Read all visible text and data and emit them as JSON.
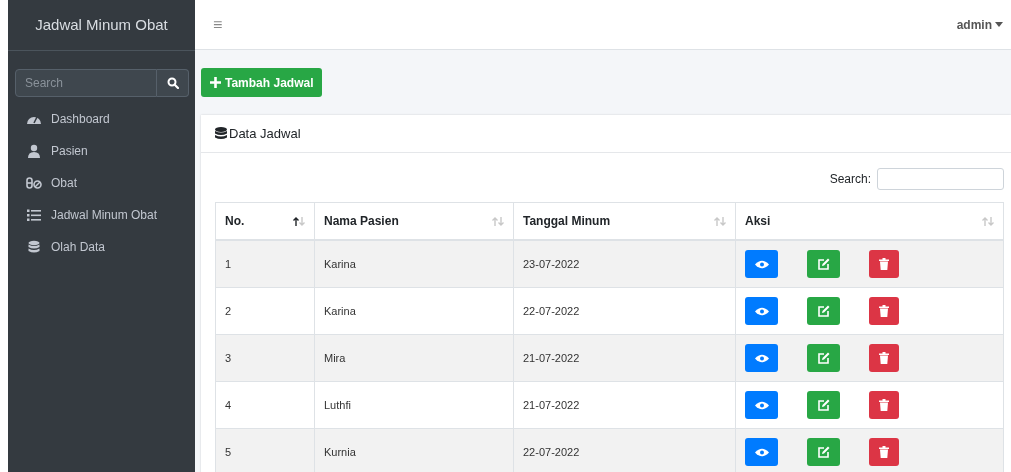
{
  "sidebar": {
    "brand": "Jadwal Minum Obat",
    "search": {
      "placeholder": "Search"
    },
    "items": [
      {
        "label": "Dashboard"
      },
      {
        "label": "Pasien"
      },
      {
        "label": "Obat"
      },
      {
        "label": "Jadwal Minum Obat"
      },
      {
        "label": "Olah Data"
      }
    ]
  },
  "topbar": {
    "menu_icon": "≡",
    "user": "admin"
  },
  "add_button": "Tambah Jadwal",
  "card": {
    "title": "Data Jadwal",
    "search_label": "Search:",
    "columns": [
      {
        "label": "No.",
        "sorted": true
      },
      {
        "label": "Nama Pasien",
        "sorted": false
      },
      {
        "label": "Tanggal Minum",
        "sorted": false
      },
      {
        "label": "Aksi",
        "sorted": false
      }
    ],
    "rows": [
      {
        "no": "1",
        "name": "Karina",
        "date": "23-07-2022"
      },
      {
        "no": "2",
        "name": "Karina",
        "date": "22-07-2022"
      },
      {
        "no": "3",
        "name": "Mira",
        "date": "21-07-2022"
      },
      {
        "no": "4",
        "name": "Luthfi",
        "date": "21-07-2022"
      },
      {
        "no": "5",
        "name": "Kurnia",
        "date": "22-07-2022"
      }
    ]
  }
}
